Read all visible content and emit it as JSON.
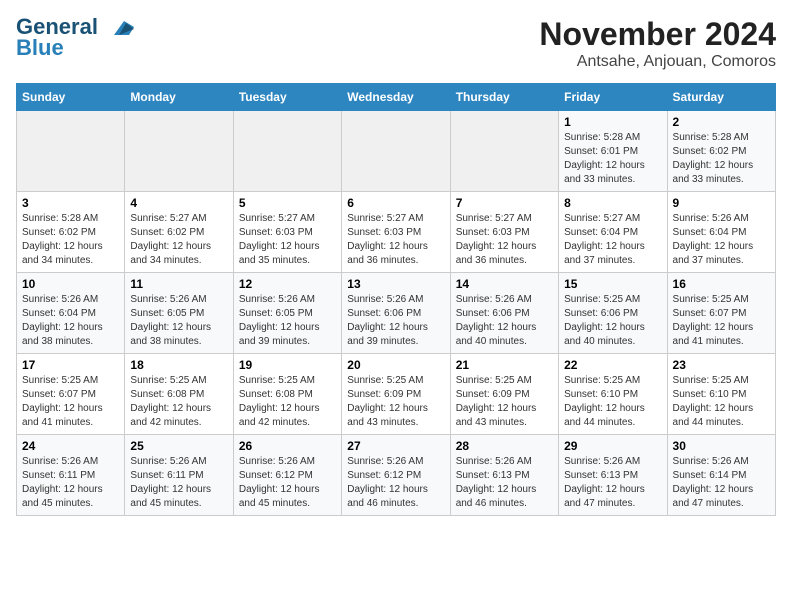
{
  "logo": {
    "line1": "General",
    "line2": "Blue"
  },
  "title": "November 2024",
  "subtitle": "Antsahe, Anjouan, Comoros",
  "days_of_week": [
    "Sunday",
    "Monday",
    "Tuesday",
    "Wednesday",
    "Thursday",
    "Friday",
    "Saturday"
  ],
  "weeks": [
    [
      {
        "day": "",
        "info": ""
      },
      {
        "day": "",
        "info": ""
      },
      {
        "day": "",
        "info": ""
      },
      {
        "day": "",
        "info": ""
      },
      {
        "day": "",
        "info": ""
      },
      {
        "day": "1",
        "info": "Sunrise: 5:28 AM\nSunset: 6:01 PM\nDaylight: 12 hours and 33 minutes."
      },
      {
        "day": "2",
        "info": "Sunrise: 5:28 AM\nSunset: 6:02 PM\nDaylight: 12 hours and 33 minutes."
      }
    ],
    [
      {
        "day": "3",
        "info": "Sunrise: 5:28 AM\nSunset: 6:02 PM\nDaylight: 12 hours and 34 minutes."
      },
      {
        "day": "4",
        "info": "Sunrise: 5:27 AM\nSunset: 6:02 PM\nDaylight: 12 hours and 34 minutes."
      },
      {
        "day": "5",
        "info": "Sunrise: 5:27 AM\nSunset: 6:03 PM\nDaylight: 12 hours and 35 minutes."
      },
      {
        "day": "6",
        "info": "Sunrise: 5:27 AM\nSunset: 6:03 PM\nDaylight: 12 hours and 36 minutes."
      },
      {
        "day": "7",
        "info": "Sunrise: 5:27 AM\nSunset: 6:03 PM\nDaylight: 12 hours and 36 minutes."
      },
      {
        "day": "8",
        "info": "Sunrise: 5:27 AM\nSunset: 6:04 PM\nDaylight: 12 hours and 37 minutes."
      },
      {
        "day": "9",
        "info": "Sunrise: 5:26 AM\nSunset: 6:04 PM\nDaylight: 12 hours and 37 minutes."
      }
    ],
    [
      {
        "day": "10",
        "info": "Sunrise: 5:26 AM\nSunset: 6:04 PM\nDaylight: 12 hours and 38 minutes."
      },
      {
        "day": "11",
        "info": "Sunrise: 5:26 AM\nSunset: 6:05 PM\nDaylight: 12 hours and 38 minutes."
      },
      {
        "day": "12",
        "info": "Sunrise: 5:26 AM\nSunset: 6:05 PM\nDaylight: 12 hours and 39 minutes."
      },
      {
        "day": "13",
        "info": "Sunrise: 5:26 AM\nSunset: 6:06 PM\nDaylight: 12 hours and 39 minutes."
      },
      {
        "day": "14",
        "info": "Sunrise: 5:26 AM\nSunset: 6:06 PM\nDaylight: 12 hours and 40 minutes."
      },
      {
        "day": "15",
        "info": "Sunrise: 5:25 AM\nSunset: 6:06 PM\nDaylight: 12 hours and 40 minutes."
      },
      {
        "day": "16",
        "info": "Sunrise: 5:25 AM\nSunset: 6:07 PM\nDaylight: 12 hours and 41 minutes."
      }
    ],
    [
      {
        "day": "17",
        "info": "Sunrise: 5:25 AM\nSunset: 6:07 PM\nDaylight: 12 hours and 41 minutes."
      },
      {
        "day": "18",
        "info": "Sunrise: 5:25 AM\nSunset: 6:08 PM\nDaylight: 12 hours and 42 minutes."
      },
      {
        "day": "19",
        "info": "Sunrise: 5:25 AM\nSunset: 6:08 PM\nDaylight: 12 hours and 42 minutes."
      },
      {
        "day": "20",
        "info": "Sunrise: 5:25 AM\nSunset: 6:09 PM\nDaylight: 12 hours and 43 minutes."
      },
      {
        "day": "21",
        "info": "Sunrise: 5:25 AM\nSunset: 6:09 PM\nDaylight: 12 hours and 43 minutes."
      },
      {
        "day": "22",
        "info": "Sunrise: 5:25 AM\nSunset: 6:10 PM\nDaylight: 12 hours and 44 minutes."
      },
      {
        "day": "23",
        "info": "Sunrise: 5:25 AM\nSunset: 6:10 PM\nDaylight: 12 hours and 44 minutes."
      }
    ],
    [
      {
        "day": "24",
        "info": "Sunrise: 5:26 AM\nSunset: 6:11 PM\nDaylight: 12 hours and 45 minutes."
      },
      {
        "day": "25",
        "info": "Sunrise: 5:26 AM\nSunset: 6:11 PM\nDaylight: 12 hours and 45 minutes."
      },
      {
        "day": "26",
        "info": "Sunrise: 5:26 AM\nSunset: 6:12 PM\nDaylight: 12 hours and 45 minutes."
      },
      {
        "day": "27",
        "info": "Sunrise: 5:26 AM\nSunset: 6:12 PM\nDaylight: 12 hours and 46 minutes."
      },
      {
        "day": "28",
        "info": "Sunrise: 5:26 AM\nSunset: 6:13 PM\nDaylight: 12 hours and 46 minutes."
      },
      {
        "day": "29",
        "info": "Sunrise: 5:26 AM\nSunset: 6:13 PM\nDaylight: 12 hours and 47 minutes."
      },
      {
        "day": "30",
        "info": "Sunrise: 5:26 AM\nSunset: 6:14 PM\nDaylight: 12 hours and 47 minutes."
      }
    ]
  ]
}
